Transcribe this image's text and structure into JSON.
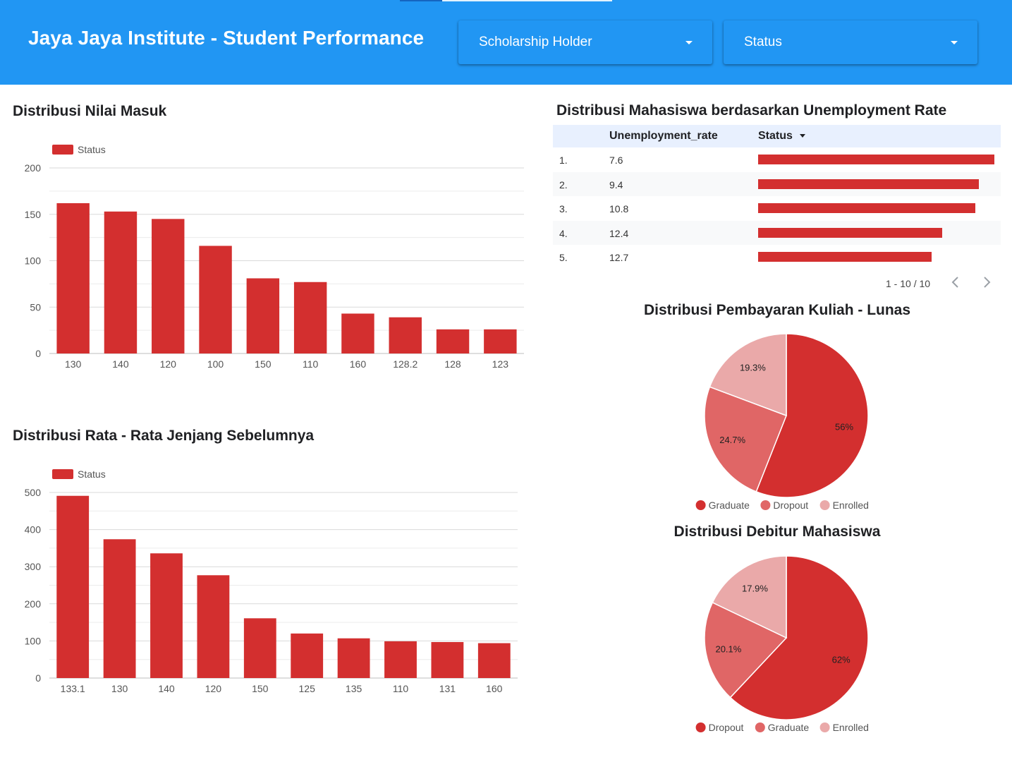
{
  "header": {
    "title": "Jaya Jaya Institute - Student Performance",
    "filters": [
      {
        "label": "Scholarship Holder"
      },
      {
        "label": "Status"
      }
    ]
  },
  "colors": {
    "header_bg": "#2196f3",
    "bar": "#d32f2f",
    "pie": [
      "#d32f2f",
      "#e06666",
      "#eaa9a9"
    ]
  },
  "sections": {
    "admission_title": "Distribusi Nilai Masuk",
    "prev_title": "Distribusi Rata - Rata Jenjang Sebelumnya",
    "unemp_title": "Distribusi Mahasiswa berdasarkan Unemployment Rate",
    "tuition_title": "Distribusi Pembayaran Kuliah - Lunas",
    "debtor_title": "Distribusi Debitur Mahasiswa"
  },
  "table": {
    "headers": [
      "Unemployment_rate",
      "Status"
    ],
    "pagination": "1 - 10 / 10",
    "rows": [
      {
        "index": "1.",
        "rate": "7.6",
        "status": 100
      },
      {
        "index": "2.",
        "rate": "9.4",
        "status": 93.5
      },
      {
        "index": "3.",
        "rate": "10.8",
        "status": 92
      },
      {
        "index": "4.",
        "rate": "12.4",
        "status": 78
      },
      {
        "index": "5.",
        "rate": "12.7",
        "status": 73.5
      }
    ],
    "status_max": 100
  },
  "chart_data": [
    {
      "id": "admission",
      "type": "bar",
      "categories": [
        "130",
        "140",
        "120",
        "100",
        "150",
        "110",
        "160",
        "128.2",
        "128",
        "123"
      ],
      "series": [
        {
          "name": "Status",
          "values": [
            162,
            153,
            145,
            116,
            81,
            77,
            43,
            39,
            26,
            26
          ]
        }
      ],
      "ylim": [
        0,
        200
      ],
      "yticks": [
        0,
        50,
        100,
        150,
        200
      ],
      "grid": true,
      "legend": "top-left"
    },
    {
      "id": "previous",
      "type": "bar",
      "categories": [
        "133.1",
        "130",
        "140",
        "120",
        "150",
        "125",
        "135",
        "110",
        "131",
        "160"
      ],
      "series": [
        {
          "name": "Status",
          "values": [
            491,
            374,
            336,
            277,
            161,
            120,
            107,
            99,
            97,
            94
          ]
        }
      ],
      "ylim": [
        0,
        500
      ],
      "yticks": [
        0,
        100,
        200,
        300,
        400,
        500
      ],
      "grid": true,
      "legend": "top-left"
    },
    {
      "id": "tuition",
      "type": "pie",
      "slices": [
        {
          "label": "Graduate",
          "value": 56,
          "text": "56%"
        },
        {
          "label": "Dropout",
          "value": 24.7,
          "text": "24.7%"
        },
        {
          "label": "Enrolled",
          "value": 19.3,
          "text": "19.3%"
        }
      ],
      "legend": "bottom"
    },
    {
      "id": "debtor",
      "type": "pie",
      "slices": [
        {
          "label": "Dropout",
          "value": 62,
          "text": "62%"
        },
        {
          "label": "Graduate",
          "value": 20.1,
          "text": "20.1%"
        },
        {
          "label": "Enrolled",
          "value": 17.9,
          "text": "17.9%"
        }
      ],
      "legend": "bottom"
    }
  ]
}
